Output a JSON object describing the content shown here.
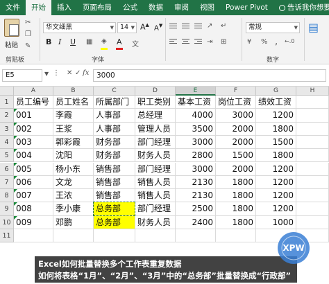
{
  "tabs": [
    "文件",
    "开始",
    "插入",
    "页面布局",
    "公式",
    "数据",
    "审阅",
    "视图",
    "Power Pivot"
  ],
  "active_tab": 1,
  "tell_me": "告诉我你想要做",
  "ribbon": {
    "paste_label": "粘贴",
    "clipboard_label": "剪贴板",
    "font_name": "华文细黑",
    "font_size": "14",
    "font_group_label": "字体",
    "number_format": "常规",
    "number_group_label": "数字",
    "bold": "B",
    "italic": "I",
    "underline": "U",
    "percent": "%",
    "comma": ","
  },
  "formula_bar": {
    "name_box": "E5",
    "fx": "fx",
    "value": "3000"
  },
  "columns": [
    "A",
    "B",
    "C",
    "D",
    "E",
    "F",
    "G",
    "H"
  ],
  "selected_column": "E",
  "rows": [
    "1",
    "2",
    "3",
    "4",
    "5",
    "6",
    "7",
    "8",
    "9",
    "10",
    "11"
  ],
  "table": {
    "headers": [
      "员工编号",
      "员工姓名",
      "所属部门",
      "职工类别",
      "基本工资",
      "岗位工资",
      "绩效工资"
    ],
    "data": [
      [
        "001",
        "李霞",
        "人事部",
        "总经理",
        "4000",
        "3000",
        "1200"
      ],
      [
        "002",
        "王浆",
        "人事部",
        "管理人员",
        "3500",
        "2000",
        "1800"
      ],
      [
        "003",
        "郭彩霞",
        "财务部",
        "部门经理",
        "3000",
        "2000",
        "1500"
      ],
      [
        "004",
        "沈阳",
        "财务部",
        "财务人员",
        "2800",
        "1500",
        "1800"
      ],
      [
        "005",
        "杨小东",
        "销售部",
        "部门经理",
        "3000",
        "2000",
        "1200"
      ],
      [
        "006",
        "文龙",
        "销售部",
        "销售人员",
        "2130",
        "1800",
        "1200"
      ],
      [
        "007",
        "王浓",
        "销售部",
        "销售人员",
        "2130",
        "1800",
        "1200"
      ],
      [
        "008",
        "季小康",
        "总务部",
        "部门经理",
        "2500",
        "1800",
        "1200"
      ],
      [
        "009",
        "邓鹏",
        "总务部",
        "财务人员",
        "2400",
        "1800",
        "1000"
      ]
    ]
  },
  "caption": {
    "line1": "Excel如何批量替换多个工作表重复数据",
    "line2": "如何将表格“1月”、“2月”、“3月”中的“总务部”批量替换成“行政部”"
  },
  "logo_text": "XPW",
  "colors": {
    "excel_green": "#217346",
    "highlight_yellow": "#ffff00",
    "logo_blue": "#3a7fd5"
  }
}
